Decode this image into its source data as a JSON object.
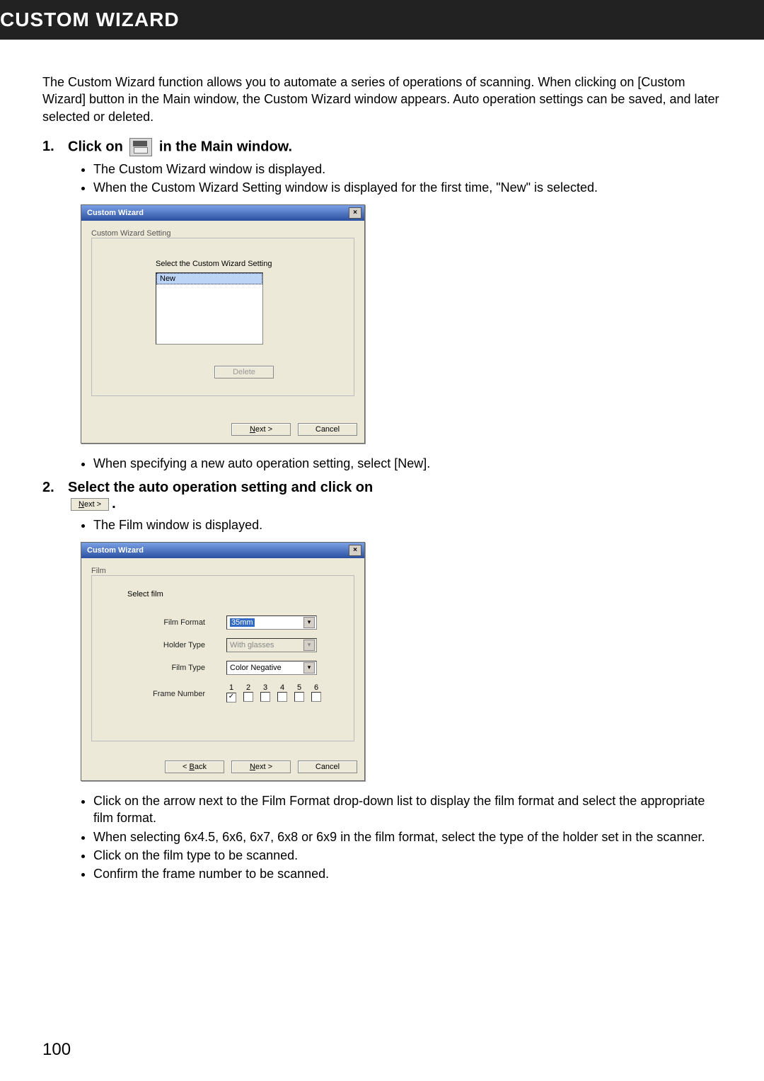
{
  "header": {
    "title": "CUSTOM WIZARD"
  },
  "intro": "The Custom Wizard function allows you to automate a series of operations of scanning. When clicking on [Custom Wizard] button in the Main window, the Custom Wizard window appears. Auto operation settings can be saved, and later selected or deleted.",
  "step1": {
    "num": "1.",
    "text_before": "Click on ",
    "text_after": " in the Main window.",
    "bullets": [
      "The Custom Wizard window is displayed.",
      "When the Custom Wizard Setting window is displayed for the first time, \"New\" is selected."
    ],
    "post_bullets": [
      "When specifying a new auto operation setting, select [New]."
    ]
  },
  "dialog1": {
    "title": "Custom Wizard",
    "close": "×",
    "group_label": "Custom Wizard Setting",
    "prompt": "Select the Custom Wizard Setting",
    "list_item": "New",
    "delete_btn": "Delete",
    "next_btn": "Next >",
    "next_u": "N",
    "cancel_btn": "Cancel"
  },
  "step2": {
    "num": "2.",
    "text": "Select the auto operation setting and click on ",
    "inline_next": "Next >",
    "inline_next_u": "N",
    "period": ".",
    "bullets_pre": [
      "The Film window is displayed."
    ],
    "bullets_post": [
      "Click on the arrow next to the Film Format drop-down list to display the film format and select the appropriate film format.",
      "When selecting 6x4.5, 6x6, 6x7, 6x8 or 6x9 in the film format, select the type of the holder set in the scanner.",
      "Click on the film type to be scanned.",
      "Confirm the frame number to be scanned."
    ]
  },
  "dialog2": {
    "title": "Custom Wizard",
    "close": "×",
    "group_label": "Film",
    "prompt": "Select film",
    "fields": {
      "format_label": "Film Format",
      "format_value": "35mm",
      "holder_label": "Holder Type",
      "holder_value": "With glasses",
      "type_label": "Film Type",
      "type_value": "Color Negative",
      "frame_label": "Frame Number"
    },
    "frames": [
      "1",
      "2",
      "3",
      "4",
      "5",
      "6"
    ],
    "frame_checks": [
      "✓",
      "",
      "",
      "",
      "",
      ""
    ],
    "back_btn": "< Back",
    "back_u": "B",
    "next_btn": "Next >",
    "next_u": "N",
    "cancel_btn": "Cancel"
  },
  "page_number": "100"
}
